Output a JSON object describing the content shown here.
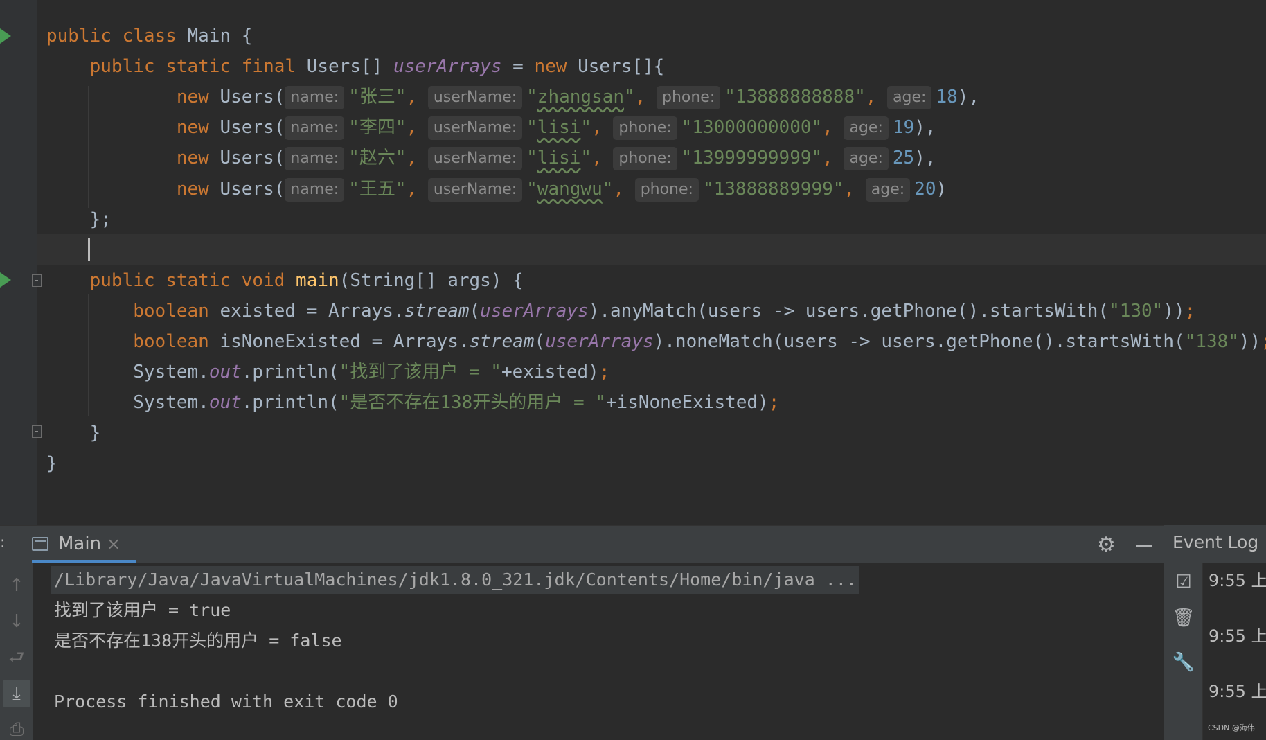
{
  "editor": {
    "lines": [
      {
        "t": [
          [
            "kw",
            "public class "
          ],
          [
            "",
            "Main {"
          ]
        ]
      },
      {
        "t": [
          [
            "",
            "    "
          ],
          [
            "kw",
            "public static final "
          ],
          [
            "",
            "Users[] "
          ],
          [
            "fld",
            "userArrays"
          ],
          [
            "",
            " = "
          ],
          [
            "kw",
            "new "
          ],
          [
            "",
            "Users[]{"
          ]
        ]
      },
      {
        "t": [
          [
            "",
            "            "
          ],
          [
            "kw",
            "new "
          ],
          [
            "",
            "Users("
          ],
          [
            "hint",
            "name:"
          ],
          [
            "str",
            "\"张三\""
          ],
          [
            "kw",
            ", "
          ],
          [
            "hint",
            "userName:"
          ],
          [
            "str",
            "\""
          ],
          [
            "str typo",
            "zhangsan"
          ],
          [
            "str",
            "\""
          ],
          [
            "kw",
            ", "
          ],
          [
            "hint",
            "phone:"
          ],
          [
            "str",
            "\"13888888888\""
          ],
          [
            "kw",
            ", "
          ],
          [
            "hint",
            "age:"
          ],
          [
            "num",
            "18"
          ],
          [
            "",
            "),"
          ]
        ]
      },
      {
        "t": [
          [
            "",
            "            "
          ],
          [
            "kw",
            "new "
          ],
          [
            "",
            "Users("
          ],
          [
            "hint",
            "name:"
          ],
          [
            "str",
            "\"李四\""
          ],
          [
            "kw",
            ", "
          ],
          [
            "hint",
            "userName:"
          ],
          [
            "str",
            "\""
          ],
          [
            "str typo",
            "lisi"
          ],
          [
            "str",
            "\""
          ],
          [
            "kw",
            ", "
          ],
          [
            "hint",
            "phone:"
          ],
          [
            "str",
            "\"13000000000\""
          ],
          [
            "kw",
            ", "
          ],
          [
            "hint",
            "age:"
          ],
          [
            "num",
            "19"
          ],
          [
            "",
            "),"
          ]
        ]
      },
      {
        "t": [
          [
            "",
            "            "
          ],
          [
            "kw",
            "new "
          ],
          [
            "",
            "Users("
          ],
          [
            "hint",
            "name:"
          ],
          [
            "str",
            "\"赵六\""
          ],
          [
            "kw",
            ", "
          ],
          [
            "hint",
            "userName:"
          ],
          [
            "str",
            "\""
          ],
          [
            "str typo",
            "lisi"
          ],
          [
            "str",
            "\""
          ],
          [
            "kw",
            ", "
          ],
          [
            "hint",
            "phone:"
          ],
          [
            "str",
            "\"13999999999\""
          ],
          [
            "kw",
            ", "
          ],
          [
            "hint",
            "age:"
          ],
          [
            "num",
            "25"
          ],
          [
            "",
            "),"
          ]
        ]
      },
      {
        "t": [
          [
            "",
            "            "
          ],
          [
            "kw",
            "new "
          ],
          [
            "",
            "Users("
          ],
          [
            "hint",
            "name:"
          ],
          [
            "str",
            "\"王五\""
          ],
          [
            "kw",
            ", "
          ],
          [
            "hint",
            "userName:"
          ],
          [
            "str",
            "\""
          ],
          [
            "str typo",
            "wangwu"
          ],
          [
            "str",
            "\""
          ],
          [
            "kw",
            ", "
          ],
          [
            "hint",
            "phone:"
          ],
          [
            "str",
            "\"13888889999\""
          ],
          [
            "kw",
            ", "
          ],
          [
            "hint",
            "age:"
          ],
          [
            "num",
            "20"
          ],
          [
            "",
            ")"
          ]
        ]
      },
      {
        "t": [
          [
            "",
            "    };"
          ]
        ]
      },
      {
        "t": [
          [
            "",
            ""
          ]
        ]
      },
      {
        "t": [
          [
            "",
            "    "
          ],
          [
            "kw",
            "public static void "
          ],
          [
            "mth",
            "main"
          ],
          [
            "",
            "(String[] args) {"
          ]
        ]
      },
      {
        "t": [
          [
            "",
            "        "
          ],
          [
            "kw",
            "boolean "
          ],
          [
            "",
            "existed = Arrays."
          ],
          [
            "it",
            "stream"
          ],
          [
            "",
            "("
          ],
          [
            "fld",
            "userArrays"
          ],
          [
            "",
            ").anyMatch(users -> users.getPhone().startsWith("
          ],
          [
            "str",
            "\"130\""
          ],
          [
            "",
            "))"
          ],
          [
            "kw",
            ";"
          ]
        ]
      },
      {
        "t": [
          [
            "",
            "        "
          ],
          [
            "kw",
            "boolean "
          ],
          [
            "",
            "isNoneExisted = Arrays."
          ],
          [
            "it",
            "stream"
          ],
          [
            "",
            "("
          ],
          [
            "fld",
            "userArrays"
          ],
          [
            "",
            ").noneMatch(users -> users.getPhone().startsWith("
          ],
          [
            "str",
            "\"138\""
          ],
          [
            "",
            "))"
          ],
          [
            "kw",
            ";"
          ]
        ]
      },
      {
        "t": [
          [
            "",
            "        System."
          ],
          [
            "fld",
            "out"
          ],
          [
            "",
            ".println("
          ],
          [
            "str",
            "\"找到了该用户 = \""
          ],
          [
            "",
            "+existed)"
          ],
          [
            "kw",
            ";"
          ]
        ]
      },
      {
        "t": [
          [
            "",
            "        System."
          ],
          [
            "fld",
            "out"
          ],
          [
            "",
            ".println("
          ],
          [
            "str",
            "\"是否不存在138开头的用户 = \""
          ],
          [
            "",
            "+isNoneExisted)"
          ],
          [
            "kw",
            ";"
          ]
        ]
      },
      {
        "t": [
          [
            "",
            "    }"
          ]
        ]
      },
      {
        "t": [
          [
            "",
            "}"
          ]
        ]
      }
    ]
  },
  "run_panel": {
    "tab_dots": ":",
    "tab_label": "Main",
    "tab_close": "×",
    "gear_icon": "⚙",
    "console": [
      "/Library/Java/JavaVirtualMachines/jdk1.8.0_321.jdk/Contents/Home/bin/java ...",
      "找到了该用户 = true",
      "是否不存在138开头的用户 = false",
      "",
      "Process finished with exit code 0"
    ]
  },
  "event_log": {
    "title": "Event Log",
    "times": [
      "9:55 上",
      "9:55 上",
      "9:55 上"
    ],
    "watermark": "CSDN @海伟"
  },
  "icons": {
    "toolbar": [
      "arrow-up-icon",
      "arrow-down-icon",
      "soft-wrap-icon",
      "scroll-to-end-icon",
      "print-icon"
    ],
    "event_tools": [
      "mark-read-icon",
      "trash-icon",
      "settings-wrench-icon"
    ]
  }
}
